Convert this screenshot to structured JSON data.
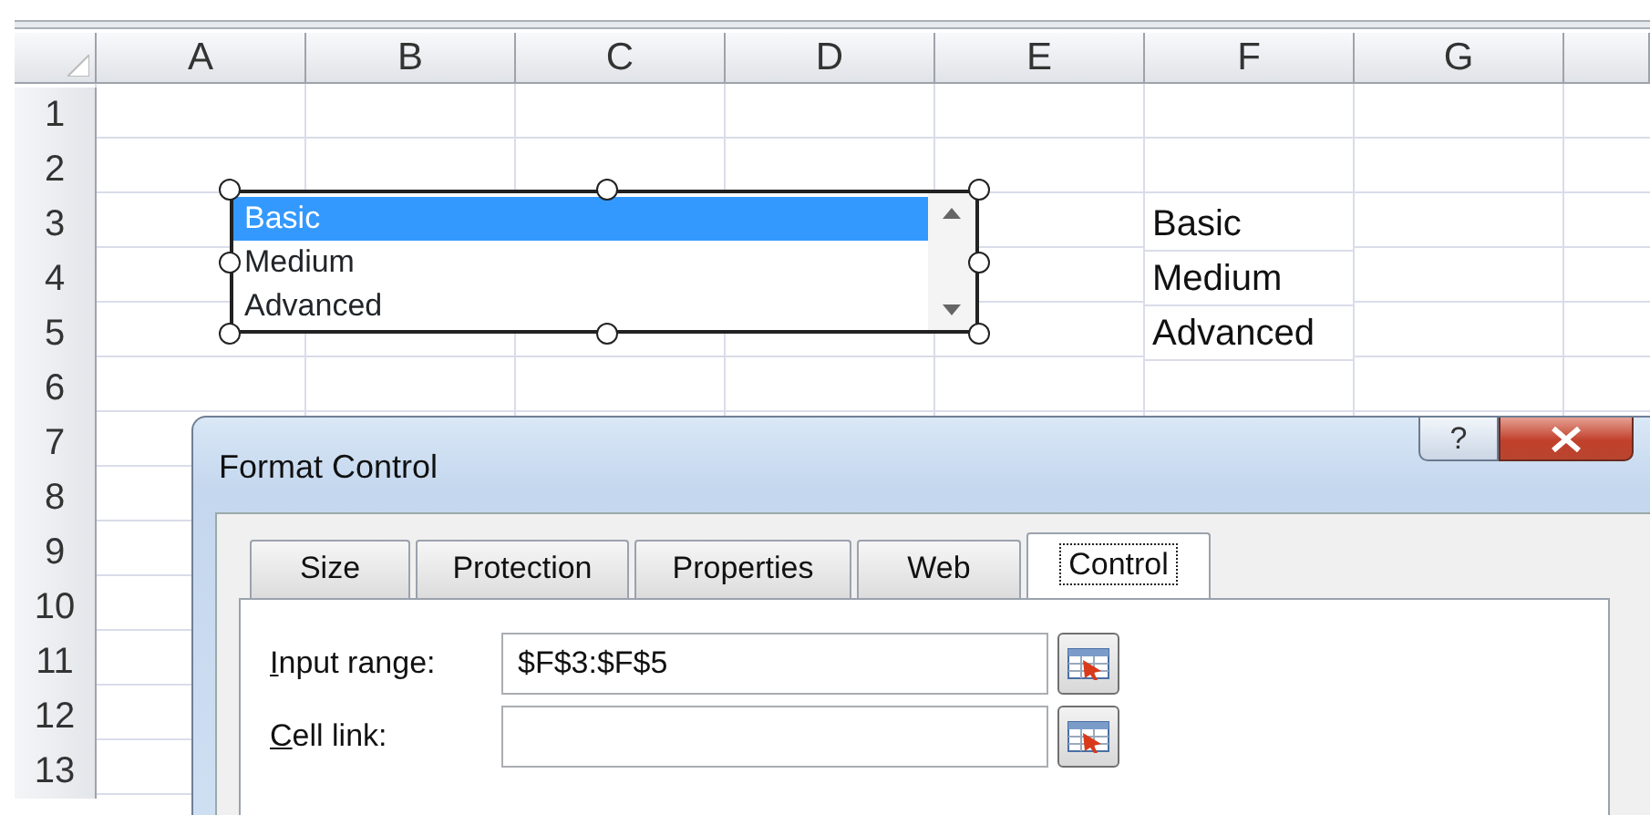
{
  "sheet": {
    "columns": [
      "A",
      "B",
      "C",
      "D",
      "E",
      "F",
      "G"
    ],
    "rows": [
      {
        "number": "1"
      },
      {
        "number": "2"
      },
      {
        "number": "3",
        "column_f": "Basic"
      },
      {
        "number": "4",
        "column_f": "Medium"
      },
      {
        "number": "5",
        "column_f": "Advanced"
      },
      {
        "number": "6"
      },
      {
        "number": "7"
      },
      {
        "number": "8"
      },
      {
        "number": "9"
      },
      {
        "number": "10"
      },
      {
        "number": "11"
      },
      {
        "number": "12"
      },
      {
        "number": "13"
      }
    ]
  },
  "list_box": {
    "items": [
      {
        "label": "Basic",
        "selected": true
      },
      {
        "label": "Medium",
        "selected": false
      },
      {
        "label": "Advanced",
        "selected": false
      }
    ]
  },
  "dialog": {
    "title": "Format Control",
    "help_button": "?",
    "tabs": [
      {
        "label": "Size",
        "selected": false
      },
      {
        "label": "Protection",
        "selected": false
      },
      {
        "label": "Properties",
        "selected": false
      },
      {
        "label": "Web",
        "selected": false
      },
      {
        "label": "Control",
        "selected": true
      }
    ],
    "fields": [
      {
        "label": "Input range:",
        "value": "$F$3:$F$5"
      },
      {
        "label": "Cell link:"
      }
    ]
  }
}
